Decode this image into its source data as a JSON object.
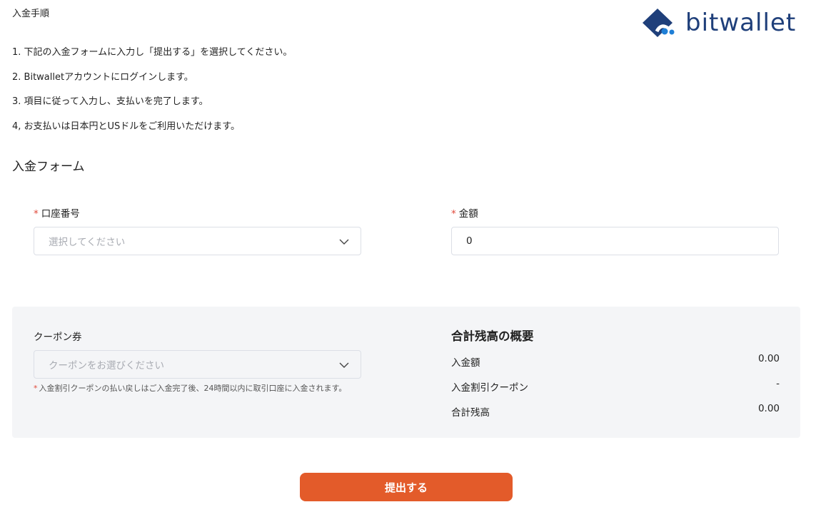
{
  "page": {
    "title": "入金手順"
  },
  "logo": {
    "text": "bitwallet",
    "brand_color": "#1f3f7a",
    "accent_color": "#1f7fd6"
  },
  "steps": [
    "1. 下記の入金フォームに入力し「提出する」を選択してください。",
    "2. Bitwalletアカウントにログインします。",
    "3. 項目に従って入力し、支払いを完了します。",
    "4, お支払いは日本円とUSドルをご利用いただけます。"
  ],
  "form": {
    "title": "入金フォーム",
    "required_mark": "*",
    "account": {
      "label": "口座番号",
      "placeholder": "選択してください",
      "icon": "chevron-down-icon"
    },
    "amount": {
      "label": "金額",
      "value": "0"
    },
    "coupon": {
      "label": "クーポン券",
      "placeholder": "クーポンをお選びください",
      "icon": "chevron-down-icon",
      "note": "入金割引クーポンの払い戻しはご入金完了後、24時間以内に取引口座に入金されます。"
    },
    "summary": {
      "title": "合計残高の概要",
      "rows": [
        {
          "label": "入金額",
          "value": "0.00"
        },
        {
          "label": "入金割引クーポン",
          "value": "-"
        },
        {
          "label": "合計残高",
          "value": "0.00"
        }
      ]
    },
    "submit_label": "提出する",
    "submit_color": "#e35b2a",
    "required_color": "#e0493a"
  }
}
